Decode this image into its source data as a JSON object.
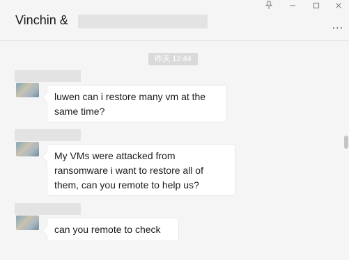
{
  "window": {
    "pin_icon": "pin-icon",
    "minimize_icon": "minimize-icon",
    "maximize_icon": "maximize-icon",
    "close_icon": "close-icon"
  },
  "header": {
    "title": "Vinchin &",
    "more_label": "..."
  },
  "chat": {
    "timestamp": "昨天 12:44",
    "messages": [
      {
        "text": "luwen can i restore many vm at the\nsame time?"
      },
      {
        "text": "My VMs were attacked from\nransomware i want to restore all of\nthem, can you remote to help us?"
      },
      {
        "text": "can you  remote to check"
      }
    ]
  },
  "colors": {
    "background": "#f5f5f5",
    "bubble": "#ffffff",
    "timestamp_pill": "#dadada",
    "redaction": "#e3e3e3"
  }
}
